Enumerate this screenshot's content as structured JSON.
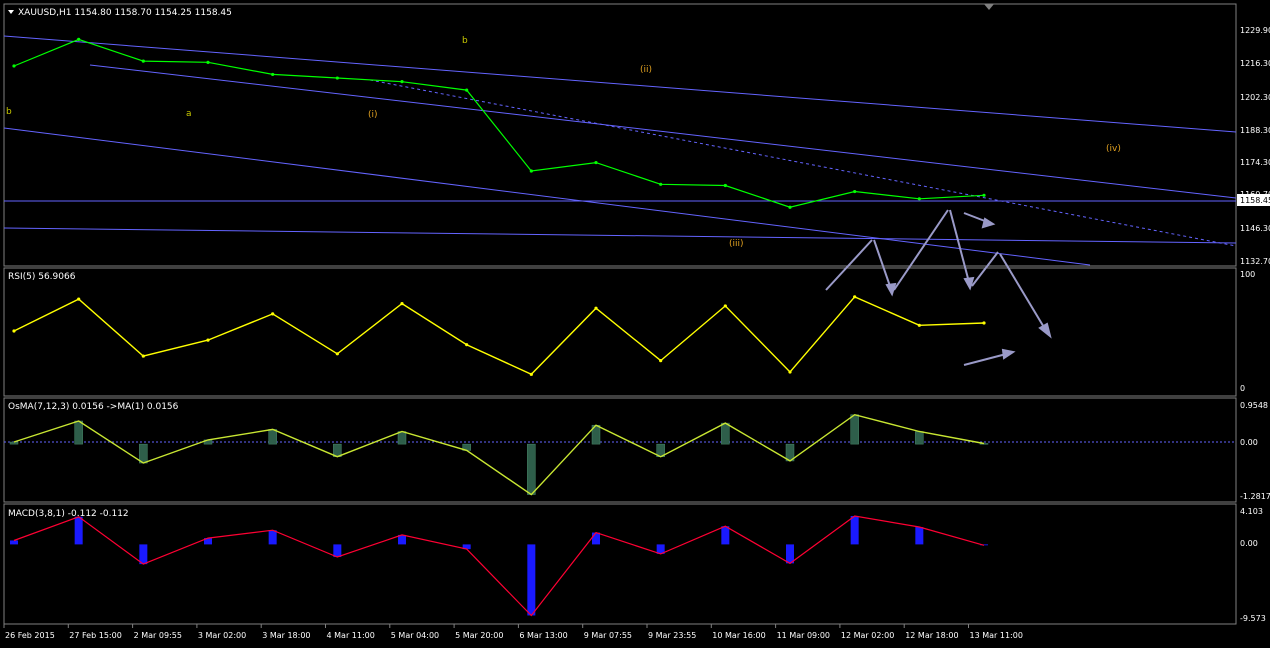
{
  "window": {
    "symbol_header": "XAUUSD,H1",
    "ohlc": [
      "1154.80",
      "1158.70",
      "1154.25",
      "1158.45"
    ],
    "current_price_label": "1158.45"
  },
  "colors": {
    "background": "#000000",
    "grid_border": "#808080",
    "price_line": "#00ff00",
    "channel_lines": "#6464ff",
    "wave_labels_main": "#e0a020",
    "wave_labels_sub": "#c8c800",
    "rsi_line": "#ffff00",
    "osma_line": "#c8e632",
    "osma_hist": "#2e5e4a",
    "macd_hist": "#1a1aff",
    "macd_signal": "#ff0033",
    "arrows": "#9a9ac8"
  },
  "price_axis": {
    "ticks": [
      "1229.90",
      "1216.30",
      "1202.30",
      "1188.30",
      "1174.30",
      "1160.70",
      "1146.30",
      "1132.70"
    ]
  },
  "time_axis": {
    "ticks": [
      "26 Feb 2015",
      "27 Feb 15:00",
      "2 Mar 09:55",
      "3 Mar 02:00",
      "3 Mar 18:00",
      "4 Mar 11:00",
      "5 Mar 04:00",
      "5 Mar 20:00",
      "6 Mar 13:00",
      "9 Mar 07:55",
      "9 Mar 23:55",
      "10 Mar 16:00",
      "11 Mar 09:00",
      "12 Mar 02:00",
      "12 Mar 18:00",
      "13 Mar 11:00"
    ]
  },
  "wave_labels": [
    {
      "text": "b",
      "group": "sub"
    },
    {
      "text": "b",
      "group": "sub"
    },
    {
      "text": "a",
      "group": "sub"
    },
    {
      "text": "(i)",
      "group": "main"
    },
    {
      "text": "(ii)",
      "group": "main"
    },
    {
      "text": "(iii)",
      "group": "main"
    },
    {
      "text": "(iv)",
      "group": "main"
    }
  ],
  "rsi": {
    "title": "RSI(5) 56.9066",
    "ticks": [
      "100",
      "0"
    ]
  },
  "osma": {
    "title": "OsMA(7,12,3) 0.0156  ->MA(1) 0.0156",
    "ticks": [
      "0.9548",
      "0.00",
      "-1.2817"
    ]
  },
  "macd": {
    "title": "MACD(3,8,1) -0.112 -0.112",
    "ticks": [
      "4.103",
      "0.00",
      "-9.573"
    ]
  },
  "chart_data": [
    {
      "type": "line",
      "name": "price",
      "x": [
        "26 Feb 2015",
        "27 Feb 15:00",
        "2 Mar 09:55",
        "3 Mar 02:00",
        "3 Mar 18:00",
        "4 Mar 11:00",
        "5 Mar 04:00",
        "5 Mar 20:00",
        "6 Mar 13:00",
        "9 Mar 07:55",
        "9 Mar 23:55",
        "10 Mar 16:00",
        "11 Mar 09:00",
        "12 Mar 02:00",
        "12 Mar 18:00",
        "13 Mar 11:00"
      ],
      "y": [
        1212.0,
        1223.0,
        1214.0,
        1213.5,
        1208.5,
        1207.0,
        1205.5,
        1202.0,
        1168.5,
        1172.0,
        1163.0,
        1162.5,
        1153.5,
        1160.0,
        1157.0,
        1158.45
      ],
      "ylim": [
        1130.0,
        1236.0
      ]
    },
    {
      "type": "line",
      "name": "rsi",
      "x": [
        "26 Feb 2015",
        "27 Feb 15:00",
        "2 Mar 09:55",
        "3 Mar 02:00",
        "3 Mar 18:00",
        "4 Mar 11:00",
        "5 Mar 04:00",
        "5 Mar 20:00",
        "6 Mar 13:00",
        "9 Mar 07:55",
        "9 Mar 23:55",
        "10 Mar 16:00",
        "11 Mar 09:00",
        "12 Mar 02:00",
        "12 Mar 18:00",
        "13 Mar 11:00"
      ],
      "y": [
        50,
        78,
        28,
        42,
        65,
        30,
        74,
        38,
        12,
        70,
        24,
        72,
        14,
        80,
        55,
        57
      ],
      "ylim": [
        0,
        100
      ]
    },
    {
      "type": "bar",
      "name": "osma",
      "x": [
        "26 Feb 2015",
        "27 Feb 15:00",
        "2 Mar 09:55",
        "3 Mar 02:00",
        "3 Mar 18:00",
        "4 Mar 11:00",
        "5 Mar 04:00",
        "5 Mar 20:00",
        "6 Mar 13:00",
        "9 Mar 07:55",
        "9 Mar 23:55",
        "10 Mar 16:00",
        "11 Mar 09:00",
        "12 Mar 02:00",
        "12 Mar 18:00",
        "13 Mar 11:00"
      ],
      "y": [
        0.05,
        0.55,
        -0.45,
        0.1,
        0.35,
        -0.3,
        0.3,
        -0.15,
        -1.2,
        0.45,
        -0.3,
        0.5,
        -0.4,
        0.7,
        0.3,
        0.0156
      ],
      "ylim": [
        -1.2817,
        0.9548
      ]
    },
    {
      "type": "bar",
      "name": "macd",
      "x": [
        "26 Feb 2015",
        "27 Feb 15:00",
        "2 Mar 09:55",
        "3 Mar 02:00",
        "3 Mar 18:00",
        "4 Mar 11:00",
        "5 Mar 04:00",
        "5 Mar 20:00",
        "6 Mar 13:00",
        "9 Mar 07:55",
        "9 Mar 23:55",
        "10 Mar 16:00",
        "11 Mar 09:00",
        "12 Mar 02:00",
        "12 Mar 18:00",
        "13 Mar 11:00"
      ],
      "y": [
        0.5,
        3.5,
        -2.5,
        0.8,
        1.8,
        -1.6,
        1.2,
        -0.6,
        -9.0,
        1.5,
        -1.2,
        2.3,
        -2.4,
        3.6,
        2.2,
        -0.112
      ],
      "ylim": [
        -9.573,
        4.103
      ]
    }
  ]
}
